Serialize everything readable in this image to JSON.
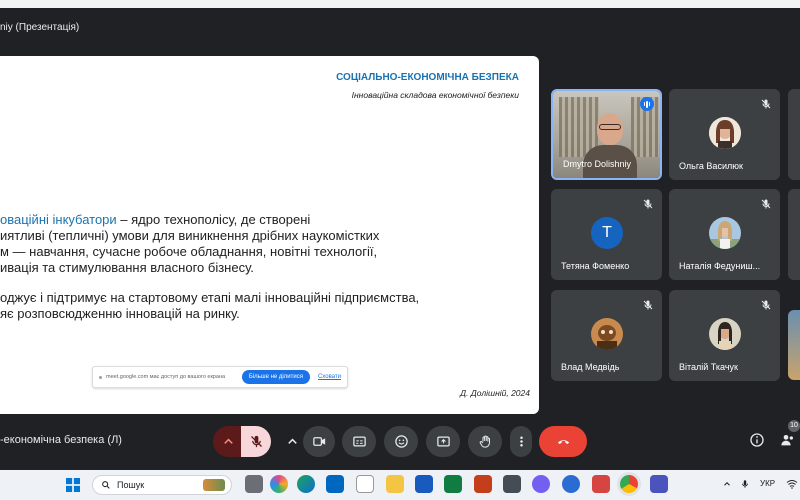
{
  "window": {
    "title": "niy (Презентація)"
  },
  "slide": {
    "title": "СОЦІАЛЬНО-ЕКОНОМІЧНА БЕЗПЕКА",
    "subtitle": "Інноваційна складова економічної безпеки",
    "para1_highlight": "оваційні інкубатори",
    "para1_line1_rest": " – ядро технополісу, де створені",
    "para1_line2": "иятливі (тепличні) умови для виникнення дрібних наукомістких",
    "para1_line3": "м — навчання, сучасне робоче обладнання, новітні технології,",
    "para1_line4": "ивація та стимулювання власного бізнесу.",
    "para2_line1": "оджує і підтримує на стартовому етапі малі інноваційні підприємства,",
    "para2_line2": "яє розповсюдженню інновацій на ринку.",
    "author": "Д. Долішній, 2024"
  },
  "share_bar": {
    "message": "meet.google.com має доступ до вашого екрана",
    "stop_label": "Більше не ділитися",
    "hide_label": "Сховати"
  },
  "participants": [
    {
      "name": "Dmytro Dolishniy",
      "speaking": true
    },
    {
      "name": "Ольга Василюк",
      "muted": true
    },
    {
      "name": "Тетяна Фоменко",
      "muted": true,
      "initial": "T",
      "color": "#1565c0"
    },
    {
      "name": "Наталія Федуниш...",
      "muted": true
    },
    {
      "name": "Влад Медвідь",
      "muted": true
    },
    {
      "name": "Віталій Ткачук",
      "muted": true
    }
  ],
  "meeting": {
    "name": "-економічна безпека (Л)",
    "participant_count": "10"
  },
  "taskbar": {
    "search_placeholder": "Пошук",
    "language": "УКР"
  },
  "colors": {
    "accent": "#1a73b0",
    "end_call": "#ea4335",
    "meet_bg": "#202124",
    "tile_bg": "#3c4043"
  }
}
